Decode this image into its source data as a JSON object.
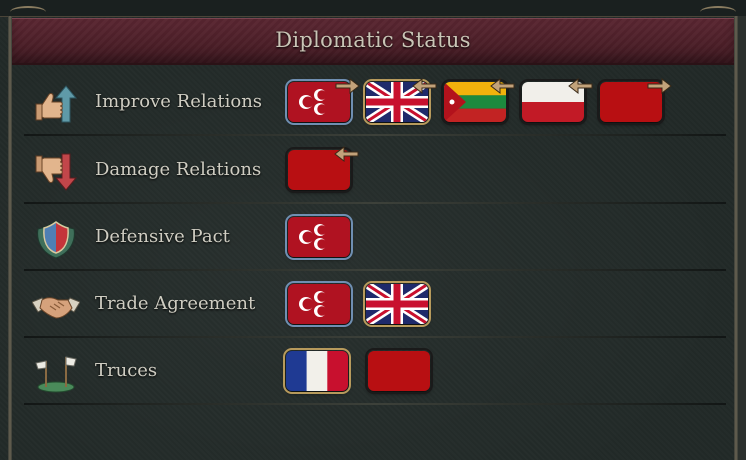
{
  "panel": {
    "title": "Diplomatic Status"
  },
  "colors": {
    "header": "#4c1f28",
    "panel_bg": "#222a28",
    "label_text": "#cfcdc2",
    "ottoman_red": "#b01221",
    "plain_red": "#b80f12"
  },
  "rows": [
    {
      "label": "Improve Relations",
      "icon": "thumbs-up-arrow-icon",
      "flags": [
        {
          "country": "ottoman-flag",
          "frame": "blue",
          "arrow": "right"
        },
        {
          "country": "britain-flag",
          "frame": "gold",
          "arrow": "left"
        },
        {
          "country": "lithuania-flag",
          "frame": "dark",
          "arrow": "left"
        },
        {
          "country": "poland-flag",
          "frame": "dark",
          "arrow": "left"
        },
        {
          "country": "red-flag",
          "frame": "dark",
          "arrow": "right"
        }
      ]
    },
    {
      "label": "Damage Relations",
      "icon": "thumbs-down-arrow-icon",
      "flags": [
        {
          "country": "red-flag",
          "frame": "dark",
          "arrow": "left"
        }
      ]
    },
    {
      "label": "Defensive Pact",
      "icon": "shield-icon",
      "flags": [
        {
          "country": "ottoman-flag",
          "frame": "blue",
          "arrow": "none"
        }
      ]
    },
    {
      "label": "Trade Agreement",
      "icon": "handshake-icon",
      "flags": [
        {
          "country": "ottoman-flag",
          "frame": "blue",
          "arrow": "none"
        },
        {
          "country": "britain-flag",
          "frame": "gold",
          "arrow": "none"
        }
      ]
    },
    {
      "label": "Truces",
      "icon": "white-flags-icon",
      "flags": [
        {
          "country": "france-flag",
          "frame": "gold",
          "arrow": "none"
        },
        {
          "country": "red-flag",
          "frame": "dark",
          "arrow": "none"
        }
      ]
    }
  ]
}
